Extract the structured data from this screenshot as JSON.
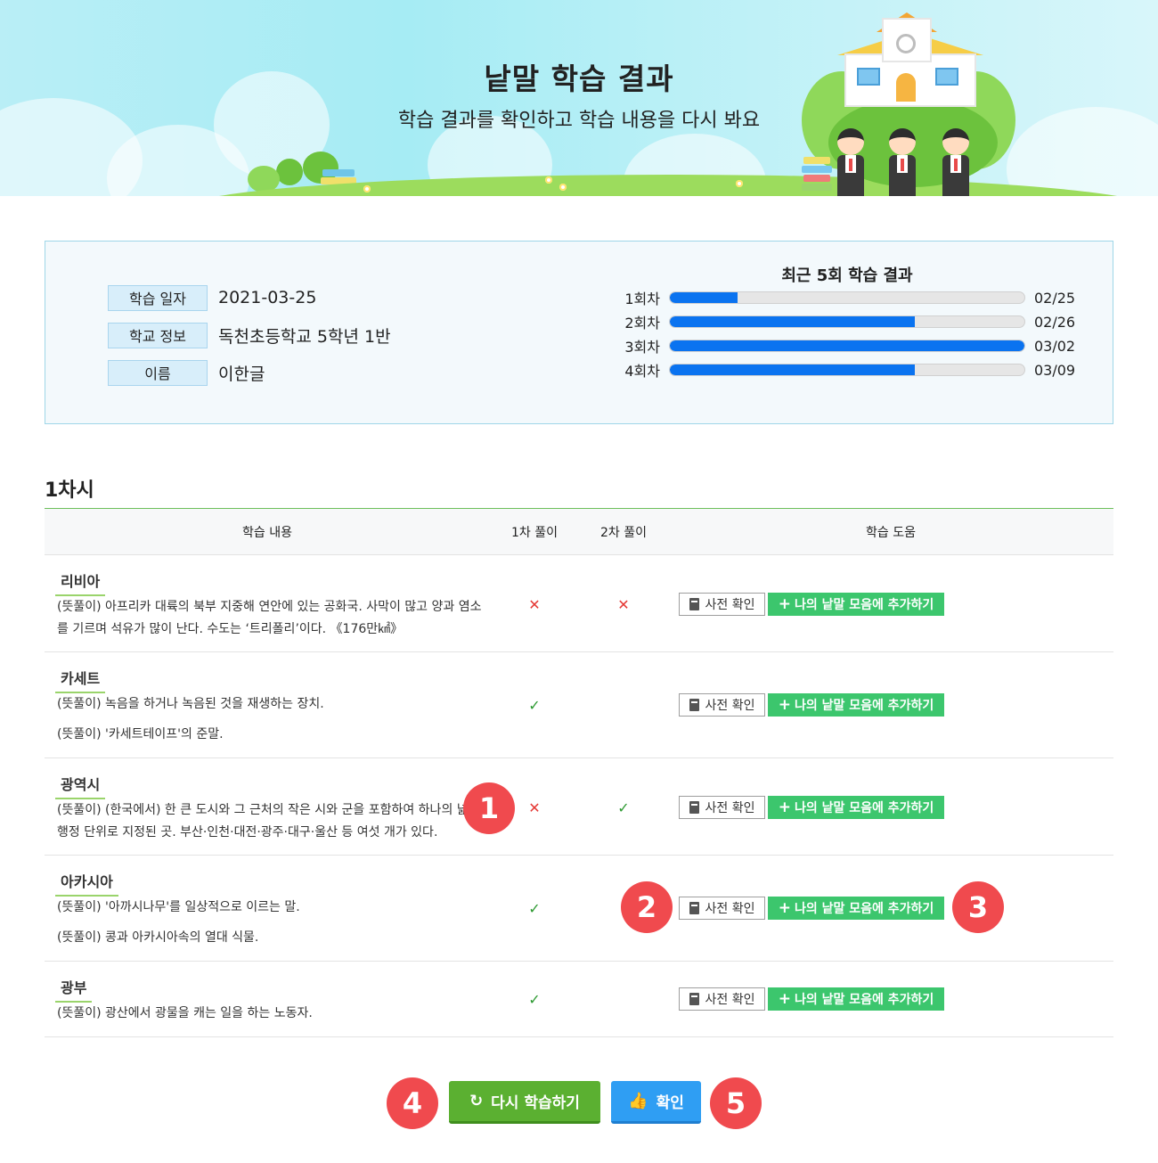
{
  "header": {
    "title": "낱말 학습 결과",
    "subtitle": "학습 결과를 확인하고 학습 내용을 다시 봐요"
  },
  "info": {
    "rows": [
      {
        "label": "학습 일자",
        "value": "2021-03-25"
      },
      {
        "label": "학교 정보",
        "value": "독천초등학교 5학년 1반"
      },
      {
        "label": "이름",
        "value": "이한글"
      }
    ]
  },
  "recent": {
    "title": "최근 5회 학습 결과",
    "items": [
      {
        "label": "1회차",
        "progress": 0.19,
        "date": "02/25"
      },
      {
        "label": "2회차",
        "progress": 0.69,
        "date": "02/26"
      },
      {
        "label": "3회차",
        "progress": 1.0,
        "date": "03/02"
      },
      {
        "label": "4회차",
        "progress": 0.69,
        "date": "03/09"
      }
    ],
    "bar_color": "#0a73f0"
  },
  "section": {
    "title": "1차시",
    "columns": [
      "학습 내용",
      "1차 풀이",
      "2차 풀이",
      "학습 도움"
    ],
    "rows": [
      {
        "word": "리비아",
        "meanings": [
          "(뜻풀이) 아프리카 대륙의 북부 지중해 연안에 있는 공화국. 사막이 많고 양과 염소를 기르며 석유가 많이 난다. 수도는 ‘트리폴리’이다. 《176만㎢》"
        ],
        "first": "x",
        "second": "x"
      },
      {
        "word": "카세트",
        "meanings": [
          "(뜻풀이) 녹음을 하거나 녹음된 것을 재생하는 장치.",
          "(뜻풀이) '카세트테이프'의 준말."
        ],
        "first": "check",
        "second": ""
      },
      {
        "word": "광역시",
        "meanings": [
          "(뜻풀이) (한국에서) 한 큰 도시와 그 근처의 작은 시와 군을 포함하여 하나의 넓은 행정 단위로 지정된 곳. 부산·인천·대전·광주·대구·울산 등 여섯 개가 있다."
        ],
        "first": "x",
        "second": "check"
      },
      {
        "word": "아카시아",
        "meanings": [
          "(뜻풀이) '아까시나무'를 일상적으로 이르는 말.",
          "(뜻풀이) 콩과 아카시아속의 열대 식물."
        ],
        "first": "check",
        "second": ""
      },
      {
        "word": "광부",
        "meanings": [
          "(뜻풀이) 광산에서 광물을 캐는 일을 하는 노동자."
        ],
        "first": "check",
        "second": ""
      }
    ],
    "dict_button": "사전 확인",
    "add_button": "나의 낱말 모음에 추가하기",
    "icons": {
      "dict": "book-icon",
      "add": "plus-icon",
      "x": "x-mark-icon",
      "check": "check-mark-icon"
    }
  },
  "badges": [
    "1",
    "2",
    "3",
    "4",
    "5"
  ],
  "footer": {
    "retry_label": "다시 학습하기",
    "ok_label": "확인",
    "retry_icon": "refresh-icon",
    "ok_icon": "thumbs-up-icon"
  },
  "colors": {
    "accent_green": "#3cc66d",
    "retry_green": "#5bb031",
    "ok_blue": "#2f9ef3",
    "badge_red": "#f04a4e",
    "wrong_red": "#e53935",
    "right_green": "#2e9a32"
  }
}
